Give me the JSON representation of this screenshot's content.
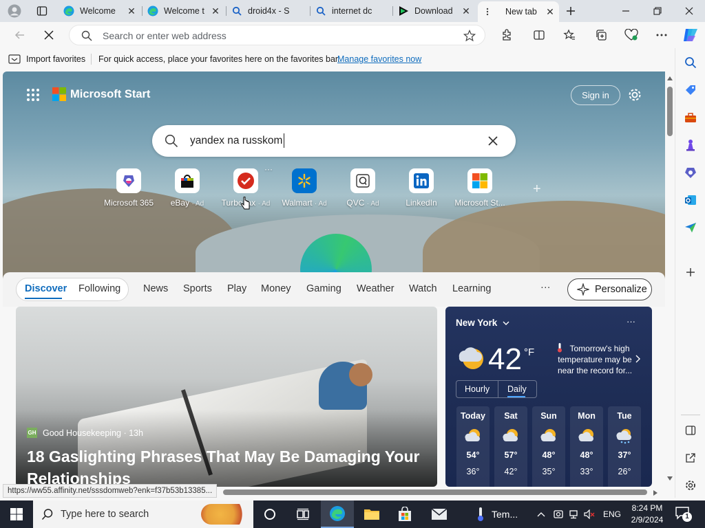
{
  "tabs": [
    {
      "label": "Welcome",
      "icon": "edge-icon"
    },
    {
      "label": "Welcome t",
      "icon": "edge-icon"
    },
    {
      "label": "droid4x - S",
      "icon": "search-icon"
    },
    {
      "label": "internet dc",
      "icon": "search-icon"
    },
    {
      "label": "Download",
      "icon": "play-icon"
    },
    {
      "label": "New tab",
      "icon": "newtab-icon"
    }
  ],
  "address_bar": {
    "placeholder": "Search or enter web address"
  },
  "favorites_bar": {
    "import_label": "Import favorites",
    "message": "For quick access, place your favorites here on the favorites bar.",
    "manage_link": "Manage favorites now"
  },
  "ms_start": {
    "brand": "Microsoft Start",
    "sign_in": "Sign in"
  },
  "search": {
    "query": "yandex na russkom"
  },
  "quick_links": [
    {
      "label": "Microsoft 365",
      "ad": ""
    },
    {
      "label": "eBay",
      "ad": "· Ad"
    },
    {
      "label": "TurboTax",
      "ad": "· Ad"
    },
    {
      "label": "Walmart",
      "ad": "· Ad"
    },
    {
      "label": "QVC",
      "ad": "· Ad"
    },
    {
      "label": "LinkedIn",
      "ad": ""
    },
    {
      "label": "Microsoft St...",
      "ad": ""
    }
  ],
  "feed_nav": {
    "items": [
      "Discover",
      "Following",
      "News",
      "Sports",
      "Play",
      "Money",
      "Gaming",
      "Weather",
      "Watch",
      "Learning"
    ],
    "more": "···",
    "personalize": "Personalize"
  },
  "article": {
    "source_badge": "GH",
    "source": "Good Housekeeping · 13h",
    "headline": "18 Gaslighting Phrases That May Be Damaging Your Relationships"
  },
  "weather": {
    "location": "New York",
    "temperature": "42",
    "unit": "°F",
    "alert": "Tomorrow's high temperature may be near the record for...",
    "toggle_hourly": "Hourly",
    "toggle_daily": "Daily",
    "forecast": [
      {
        "day": "Today",
        "high": "54°",
        "low": "36°"
      },
      {
        "day": "Sat",
        "high": "57°",
        "low": "42°"
      },
      {
        "day": "Sun",
        "high": "48°",
        "low": "35°"
      },
      {
        "day": "Mon",
        "high": "48°",
        "low": "33°"
      },
      {
        "day": "Tue",
        "high": "37°",
        "low": "26°"
      }
    ]
  },
  "status_url": "https://ww55.affinity.net/sssdomweb?enk=f37b53b13385...",
  "taskbar": {
    "search_placeholder": "Type here to search",
    "weather_widget": "Tem...",
    "language": "ENG",
    "time": "8:24 PM",
    "date": "2/9/2024",
    "notification_count": "1"
  }
}
